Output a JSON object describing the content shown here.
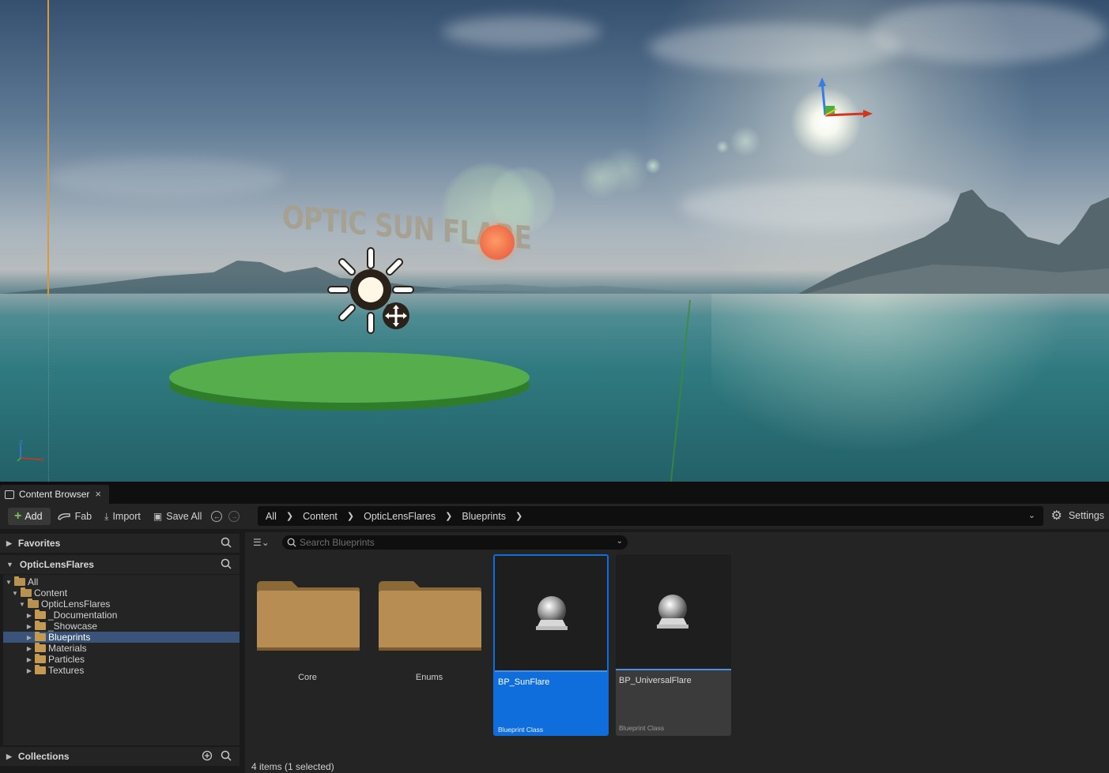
{
  "viewport": {
    "overlay_text": "OPTIC SUN FLARE"
  },
  "content_browser": {
    "tab_title": "Content Browser",
    "tab_close": "×",
    "toolbar": {
      "add_label": "Add",
      "fab_label": "Fab",
      "import_label": "Import",
      "save_all_label": "Save All",
      "settings_label": "Settings"
    },
    "breadcrumbs": [
      "All",
      "Content",
      "OpticLensFlares",
      "Blueprints"
    ],
    "sidebar": {
      "favorites_label": "Favorites",
      "project_label": "OpticLensFlares",
      "collections_label": "Collections",
      "tree": [
        {
          "label": "All"
        },
        {
          "label": "Content"
        },
        {
          "label": "OpticLensFlares"
        },
        {
          "label": "_Documentation"
        },
        {
          "label": "_Showcase"
        },
        {
          "label": "Blueprints"
        },
        {
          "label": "Materials"
        },
        {
          "label": "Particles"
        },
        {
          "label": "Textures"
        }
      ]
    },
    "search": {
      "placeholder": "Search Blueprints"
    },
    "items": [
      {
        "name": "Core",
        "kind": "folder"
      },
      {
        "name": "Enums",
        "kind": "folder"
      },
      {
        "name": "BP_SunFlare",
        "kind": "asset",
        "class_label": "Blueprint Class",
        "selected": true
      },
      {
        "name": "BP_UniversalFlare",
        "kind": "asset",
        "class_label": "Blueprint Class",
        "selected": false
      }
    ],
    "status_text": "4 items (1 selected)"
  },
  "colors": {
    "selection_blue": "#0f6edb",
    "tree_selection": "#395478",
    "folder_tan": "#c49a52",
    "add_green": "#6fc75a"
  }
}
